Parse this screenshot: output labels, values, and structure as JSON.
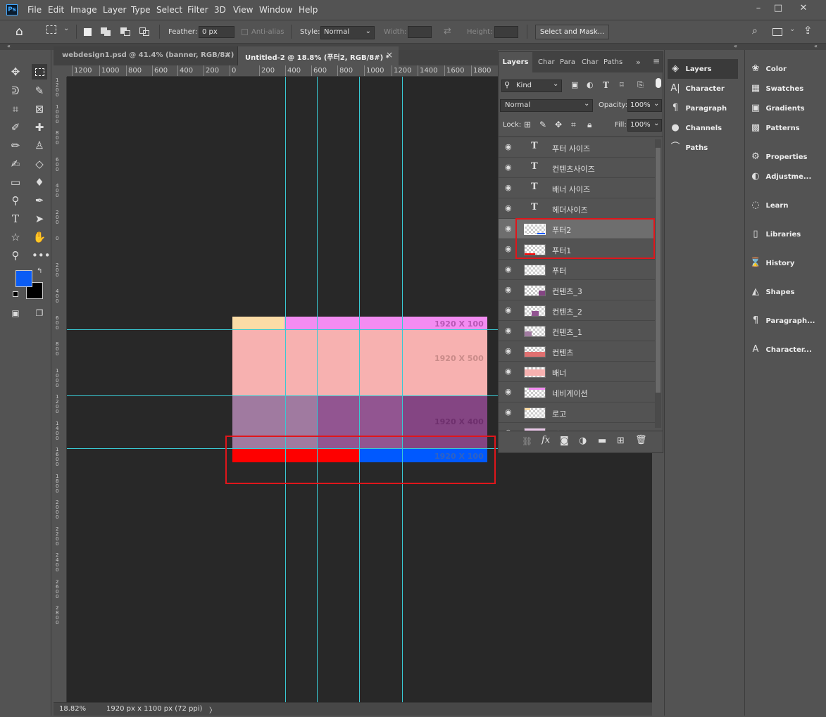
{
  "app": {
    "logo": "Ps",
    "menu": [
      "File",
      "Edit",
      "Image",
      "Layer",
      "Type",
      "Select",
      "Filter",
      "3D",
      "View",
      "Window",
      "Help"
    ]
  },
  "window_controls": [
    "–",
    "□",
    "✕"
  ],
  "options": {
    "feather_label": "Feather:",
    "feather_value": "0 px",
    "antialias_label": "Anti-alias",
    "style_label": "Style:",
    "style_value": "Normal",
    "width_label": "Width:",
    "height_label": "Height:",
    "select_mask": "Select and Mask..."
  },
  "doc_tabs": [
    {
      "label": "webdesign1.psd @ 41.4% (banner, RGB/8#)",
      "close": "×"
    },
    {
      "label": "Untitled-2 @ 18.8% (푸터2, RGB/8#) *",
      "close": "×"
    }
  ],
  "ruler_h": [
    "1200",
    "1000",
    "800",
    "600",
    "400",
    "200",
    "0",
    "200",
    "400",
    "600",
    "800",
    "1000",
    "1200",
    "1400",
    "1600",
    "1800"
  ],
  "ruler_v": [
    "1\n2\n0\n0",
    "1\n0\n0\n0",
    "8\n0\n0",
    "6\n0\n0",
    "4\n0\n0",
    "2\n0\n0",
    "0",
    "2\n0\n0",
    "4\n0\n0",
    "6\n0\n0",
    "8\n0\n0",
    "1\n0\n0\n0",
    "1\n2\n0\n0",
    "1\n4\n0\n0",
    "1\n6\n0\n0",
    "1\n8\n0\n0",
    "2\n0\n0\n0",
    "2\n2\n0\n0",
    "2\n4\n0\n0",
    "2\n6\n0\n0",
    "2\n8\n0\n0"
  ],
  "canvas": {
    "labels": {
      "header": "1920 X 100",
      "banner": "1920 X 500",
      "content": "1920 X 400",
      "footer": "1920 X 100"
    },
    "colors": {
      "bg": "#282828",
      "logo": "#fbdca6",
      "nav": "#f38cf2",
      "banner": "#f7b1b0",
      "content_1": "#a07aa0",
      "content_2": "#925591",
      "content_3": "#844583",
      "footer_1": "#fe0000",
      "footer_2": "#0059ff",
      "guide": "#39c9d3",
      "highlight": "#e0161b"
    }
  },
  "status": {
    "zoom": "18.82%",
    "doc_info": "1920 px x 1100 px (72 ppi)",
    "arrow": "〉"
  },
  "layers_panel": {
    "tabs": [
      "Layers",
      "Char",
      "Para",
      "Char",
      "Paths"
    ],
    "filter_kind": "Kind",
    "blend_mode": "Normal",
    "opacity_label": "Opacity:",
    "opacity_value": "100%",
    "lock_label": "Lock:",
    "fill_label": "Fill:",
    "fill_value": "100%",
    "layers": [
      {
        "name": "푸터 사이즈",
        "type": "text"
      },
      {
        "name": "컨텐츠사이즈",
        "type": "text"
      },
      {
        "name": "배너 사이즈",
        "type": "text"
      },
      {
        "name": "헤더사이즈",
        "type": "text"
      },
      {
        "name": "푸터2",
        "type": "pixel",
        "selected": true
      },
      {
        "name": "푸터1",
        "type": "pixel"
      },
      {
        "name": "푸터",
        "type": "pixel"
      },
      {
        "name": "컨텐츠_3",
        "type": "pixel"
      },
      {
        "name": "컨텐츠_2",
        "type": "pixel"
      },
      {
        "name": "컨텐츠_1",
        "type": "pixel"
      },
      {
        "name": "컨텐츠",
        "type": "pixel"
      },
      {
        "name": "배너",
        "type": "pixel"
      },
      {
        "name": "네비게이션",
        "type": "pixel"
      },
      {
        "name": "로고",
        "type": "pixel"
      },
      {
        "name": "헤더",
        "type": "pixel"
      }
    ]
  },
  "dock1": [
    {
      "label": "Layers",
      "icon": "layers-icon",
      "glyph": "◈"
    },
    {
      "label": "Character",
      "icon": "character-icon",
      "glyph": "A|"
    },
    {
      "label": "Paragraph",
      "icon": "paragraph-icon",
      "glyph": "¶"
    },
    {
      "label": "Channels",
      "icon": "channels-icon",
      "glyph": "●"
    },
    {
      "label": "Paths",
      "icon": "paths-icon",
      "glyph": "⌒"
    }
  ],
  "dock2": [
    {
      "label": "Color",
      "icon": "color-icon",
      "glyph": "❀"
    },
    {
      "label": "Swatches",
      "icon": "swatches-icon",
      "glyph": "▦"
    },
    {
      "label": "Gradients",
      "icon": "gradients-icon",
      "glyph": "▣"
    },
    {
      "label": "Patterns",
      "icon": "patterns-icon",
      "glyph": "▩"
    },
    {
      "label": "Properties",
      "icon": "properties-icon",
      "glyph": "⚙"
    },
    {
      "label": "Adjustme...",
      "icon": "adjustments-icon",
      "glyph": "◐"
    },
    {
      "label": "Learn",
      "icon": "learn-icon",
      "glyph": "◌"
    },
    {
      "label": "Libraries",
      "icon": "libraries-icon",
      "glyph": "▯"
    },
    {
      "label": "History",
      "icon": "history-icon",
      "glyph": "⌛"
    },
    {
      "label": "Shapes",
      "icon": "shapes-icon",
      "glyph": "◭"
    },
    {
      "label": "Paragraph...",
      "icon": "paragraph-styles-icon",
      "glyph": "¶"
    },
    {
      "label": "Character...",
      "icon": "character-styles-icon",
      "glyph": "A"
    }
  ],
  "fg_color": "#0a5cf5",
  "bg_color": "#000000"
}
